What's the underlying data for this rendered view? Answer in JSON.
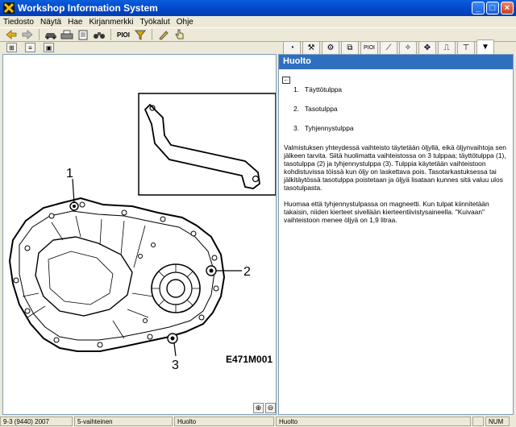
{
  "window": {
    "title": "Workshop Information System"
  },
  "menu": [
    "Tiedosto",
    "Näytä",
    "Hae",
    "Kirjanmerkki",
    "Työkalut",
    "Ohje"
  ],
  "toolbar": {
    "pioi_label": "PIOI"
  },
  "tabs": {
    "pioi_label": "PIOI"
  },
  "section": {
    "title": "Huolto"
  },
  "figure": {
    "code": "E471M001",
    "callouts": [
      "1",
      "2",
      "3"
    ]
  },
  "content": {
    "items": [
      {
        "num": "1.",
        "label": "Täyttötulppa"
      },
      {
        "num": "2.",
        "label": "Tasotulppa"
      },
      {
        "num": "3.",
        "label": "Tyhjennystulppa"
      }
    ],
    "paragraph1": "Valmistuksen yhteydessä vaihteisto täytetään öljyllä, eikä öljynvaihtoja sen jälkeen tarvita. Siitä huolimatta vaihteistossa on 3 tulppaa; täyttötulppa (1), tasotulppa (2) ja tyhjennystulppa (3). Tulppia käytetään vaihteistoon kohdistuvissa töissä kun öljy on laskettava pois. Tasotarkastuksessa tai jälkitäytössä tasotulppa poistetaan ja öljyä lisataan kunnes sitä valuu ulos tasotulpasta.",
    "paragraph2": "Huomaa että tyhjennystulpassa on magneetti. Kun tulpat kiinnitetään takaisin, niiden kierteet sivellään kierteentiivistysaineella. \"Kuivaan\" vaihteistoon menee öljyä on 1,9 litraa."
  },
  "status": {
    "model": "9-3 (9440) 2007",
    "gearbox": "5-vaihteinen",
    "section1": "Huolto",
    "section2": "Huolto",
    "num": "NUM"
  }
}
